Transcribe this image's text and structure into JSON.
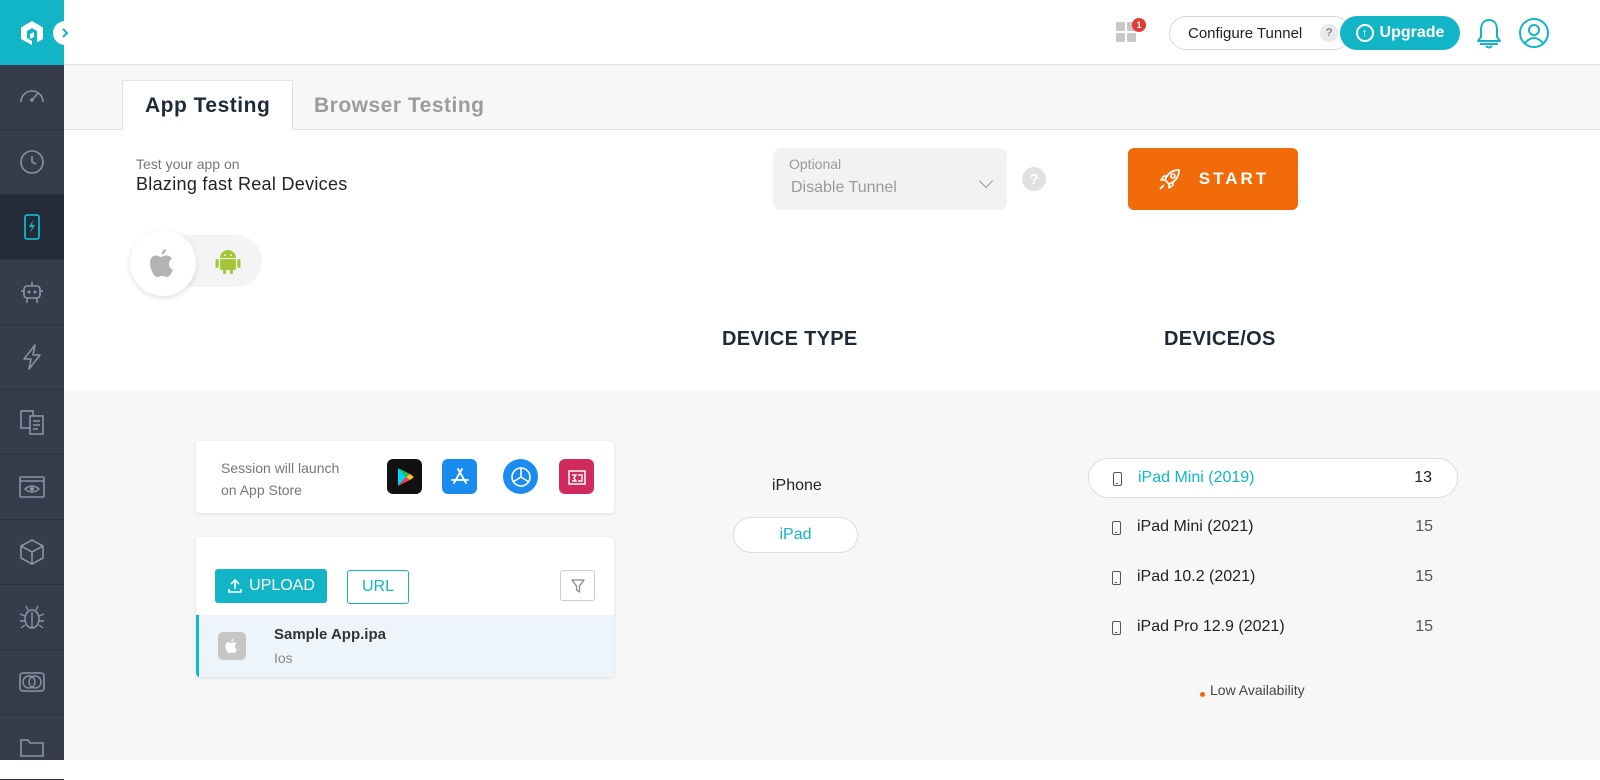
{
  "sidebar": {
    "items": [
      {
        "name": "dashboard",
        "icon": "speedometer-icon"
      },
      {
        "name": "history",
        "icon": "clock-icon"
      },
      {
        "name": "real-device",
        "icon": "mobile-bolt-icon",
        "active": true
      },
      {
        "name": "automation",
        "icon": "robot-icon"
      },
      {
        "name": "hyperexecute",
        "icon": "lightning-icon"
      },
      {
        "name": "test-manager",
        "icon": "documents-icon"
      },
      {
        "name": "visual-testing",
        "icon": "eye-browser-icon"
      },
      {
        "name": "integrations",
        "icon": "box-icon"
      },
      {
        "name": "issue-tracker",
        "icon": "bug-icon"
      },
      {
        "name": "compare",
        "icon": "overlap-circles-icon"
      },
      {
        "name": "files",
        "icon": "folder-icon"
      }
    ]
  },
  "header": {
    "notification_count": "1",
    "configure_tunnel_label": "Configure Tunnel",
    "tunnel_help": "?",
    "upgrade_label": "Upgrade"
  },
  "tabs": [
    {
      "label": "App Testing",
      "active": true
    },
    {
      "label": "Browser Testing",
      "active": false
    }
  ],
  "intro": {
    "subtitle": "Test your app on",
    "title": "Blazing fast Real Devices"
  },
  "tunnel_select": {
    "label": "Optional",
    "value": "Disable Tunnel",
    "help": "?"
  },
  "start_label": "START",
  "os_toggle": {
    "selected": "ios",
    "options": [
      "ios",
      "android"
    ]
  },
  "columns": {
    "device_type": "DEVICE TYPE",
    "device_os": "DEVICE/OS"
  },
  "store_card": {
    "line1": "Session will launch",
    "line2": "on App Store",
    "stores": [
      "google-play",
      "app-store",
      "app-center",
      "testflight"
    ]
  },
  "upload": {
    "upload_label": "UPLOAD",
    "url_label": "URL",
    "apps": [
      {
        "name": "Sample App.ipa",
        "os": "Ios"
      }
    ]
  },
  "device_types": [
    {
      "label": "iPhone",
      "selected": false
    },
    {
      "label": "iPad",
      "selected": true
    }
  ],
  "devices": [
    {
      "name": "iPad Mini (2019)",
      "version": "13",
      "selected": true
    },
    {
      "name": "iPad Mini (2021)",
      "version": "15",
      "selected": false
    },
    {
      "name": "iPad 10.2 (2021)",
      "version": "15",
      "selected": false
    },
    {
      "name": "iPad Pro 12.9 (2021)",
      "version": "15",
      "selected": false
    }
  ],
  "legend": {
    "low_availability": "Low Availability"
  },
  "colors": {
    "brand": "#12b5c6",
    "start": "#f26b0a",
    "sidebar": "#353d4d",
    "badge": "#e53935"
  }
}
